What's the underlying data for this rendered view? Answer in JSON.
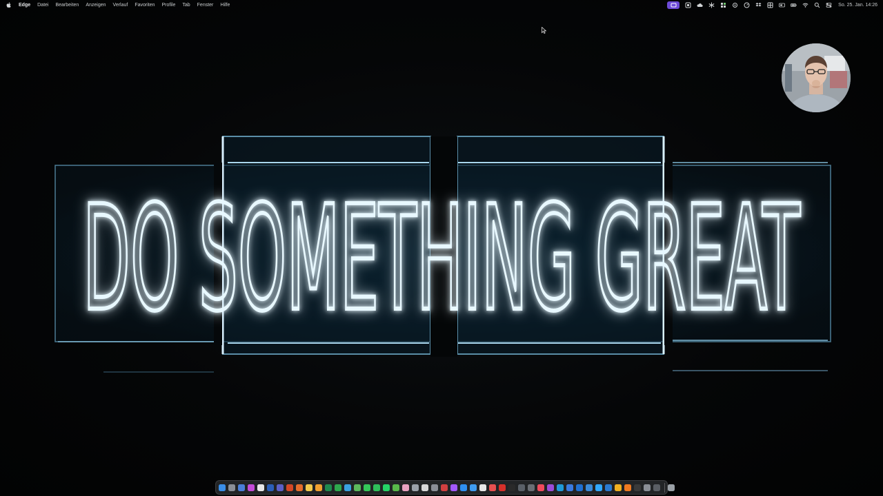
{
  "menubar": {
    "app_name": "Edge",
    "items": [
      "Datei",
      "Bearbeiten",
      "Anzeigen",
      "Verlauf",
      "Favoriten",
      "Profile",
      "Tab",
      "Fenster",
      "Hilfe"
    ],
    "status_icons": [
      "screen-share-icon",
      "window-icon",
      "cloud-icon",
      "snowflake-icon",
      "puzzle-icon",
      "settings-icon",
      "dial-icon",
      "dropbox-icon",
      "grid-icon",
      "window-icon",
      "battery-icon",
      "wifi-icon",
      "search-icon",
      "control-center-icon"
    ],
    "status_accent": "#6d4bd8",
    "clock": "So. 25. Jan.  14:26"
  },
  "wallpaper": {
    "sign_text": "DO SOMETHING GREAT",
    "neon_color": "#dff4ff",
    "glow_color": "#3fb0e8"
  },
  "webcam": {
    "label": "webcam-overlay"
  },
  "dock": {
    "apps": [
      {
        "name": "finder",
        "color": "#3a8ee8"
      },
      {
        "name": "launchpad",
        "color": "#8a8e96"
      },
      {
        "name": "safari",
        "color": "#4a7ed8"
      },
      {
        "name": "arc",
        "color": "#c44bd8"
      },
      {
        "name": "notion",
        "color": "#e8e8e8"
      },
      {
        "name": "word",
        "color": "#2b5eb8"
      },
      {
        "name": "teams",
        "color": "#5b5fc7"
      },
      {
        "name": "powerpoint",
        "color": "#d24726"
      },
      {
        "name": "office",
        "color": "#e36c2b"
      },
      {
        "name": "notes",
        "color": "#f2c94c"
      },
      {
        "name": "pages",
        "color": "#f0a030"
      },
      {
        "name": "excel",
        "color": "#1f8a4f"
      },
      {
        "name": "numbers",
        "color": "#2ea84d"
      },
      {
        "name": "keynote",
        "color": "#3aa0e0"
      },
      {
        "name": "chrome",
        "color": "#5cb85c"
      },
      {
        "name": "messages",
        "color": "#34c759"
      },
      {
        "name": "facetime",
        "color": "#2fbf5a"
      },
      {
        "name": "whatsapp",
        "color": "#25d366"
      },
      {
        "name": "maps",
        "color": "#58b84a"
      },
      {
        "name": "photos",
        "color": "#e8a0c0"
      },
      {
        "name": "preview",
        "color": "#9aa0a8"
      },
      {
        "name": "textedit",
        "color": "#d8d8d8"
      },
      {
        "name": "settings",
        "color": "#8a8e96"
      },
      {
        "name": "vpn",
        "color": "#d04040"
      },
      {
        "name": "figma",
        "color": "#a259ff"
      },
      {
        "name": "app-store",
        "color": "#2f8ff0"
      },
      {
        "name": "mail",
        "color": "#3f9cf0"
      },
      {
        "name": "calendar",
        "color": "#e8e8e8"
      },
      {
        "name": "reminders",
        "color": "#e85050"
      },
      {
        "name": "acrobat",
        "color": "#d6302a"
      },
      {
        "name": "terminal",
        "color": "#2a2a2a"
      },
      {
        "name": "activity-monitor",
        "color": "#5a6068"
      },
      {
        "name": "screenshot",
        "color": "#6a6e74"
      },
      {
        "name": "music",
        "color": "#f04a5c"
      },
      {
        "name": "podcasts",
        "color": "#9b4cd8"
      },
      {
        "name": "edge",
        "color": "#1f9ad8"
      },
      {
        "name": "xcode",
        "color": "#3a7ae0"
      },
      {
        "name": "outlook",
        "color": "#1f6fd0"
      },
      {
        "name": "onedrive",
        "color": "#3a8ad8"
      },
      {
        "name": "photoshop",
        "color": "#31a8ff"
      },
      {
        "name": "vs-code",
        "color": "#2a7ad0"
      },
      {
        "name": "sketch",
        "color": "#f0b020"
      },
      {
        "name": "illustrator",
        "color": "#f07a20"
      },
      {
        "name": "obs",
        "color": "#3a3a3a"
      },
      {
        "name": "utility",
        "color": "#8a8e96"
      },
      {
        "name": "archive",
        "color": "#5a5e64"
      }
    ],
    "trash": {
      "name": "trash",
      "color": "#9aa0a6"
    }
  }
}
